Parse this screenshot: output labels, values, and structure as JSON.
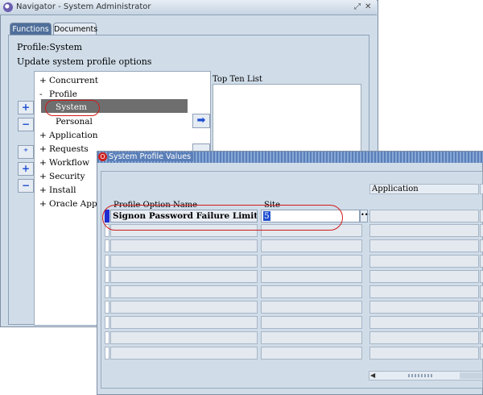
{
  "navigator": {
    "title": "Navigator - System Administrator",
    "tabs": [
      {
        "label": "Functions",
        "active": true
      },
      {
        "label": "Documents",
        "active": false
      }
    ],
    "profile_label": "Profile:System",
    "heading": "Update system profile options",
    "tree": [
      {
        "prefix": "+",
        "label": "Concurrent"
      },
      {
        "prefix": "-",
        "label": "Profile"
      },
      {
        "prefix": "",
        "label": "System",
        "selected": true
      },
      {
        "prefix": "",
        "label": "Personal"
      },
      {
        "prefix": "+",
        "label": "Application"
      },
      {
        "prefix": "+",
        "label": "Requests"
      },
      {
        "prefix": "+",
        "label": "Workflow"
      },
      {
        "prefix": "+",
        "label": "Security"
      },
      {
        "prefix": "+",
        "label": "Install"
      },
      {
        "prefix": "+",
        "label": "Oracle Applic"
      }
    ],
    "top_ten_label": "Top Ten List"
  },
  "profile_values": {
    "title": "System Profile Values",
    "application_header": "Application",
    "columns": {
      "profile_option_name": "Profile Option Name",
      "site": "Site"
    },
    "rows": [
      {
        "name": "Signon Password Failure Limit",
        "site": "5"
      }
    ]
  },
  "colors": {
    "window_bg": "#d0dde9",
    "selection": "#6e6e6e",
    "highlight_oval": "#d11a1a",
    "active_tab": "#4f6f9a"
  }
}
